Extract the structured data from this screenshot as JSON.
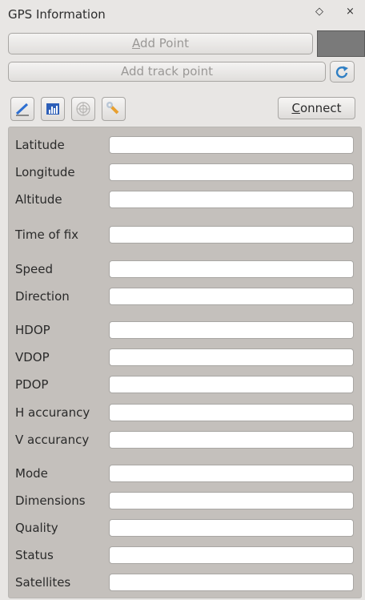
{
  "window": {
    "title": "GPS Information",
    "float_icon": "◇",
    "close_icon": "×"
  },
  "toolbar": {
    "add_point_prefix": "",
    "add_point_underline": "A",
    "add_point_rest": "dd Point",
    "add_track_point": "Add track point",
    "connect_underline": "C",
    "connect_rest": "onnect",
    "track_color": "#7a7a7a"
  },
  "tools": [
    {
      "name": "track-style-icon"
    },
    {
      "name": "signal-histogram-icon"
    },
    {
      "name": "satellite-polar-icon"
    },
    {
      "name": "settings-wrench-icon"
    }
  ],
  "fields": [
    {
      "label": "Latitude",
      "value": ""
    },
    {
      "label": "Longitude",
      "value": ""
    },
    {
      "label": "Altitude",
      "value": ""
    },
    {
      "label": "Time of fix",
      "value": ""
    },
    {
      "label": "Speed",
      "value": ""
    },
    {
      "label": "Direction",
      "value": ""
    },
    {
      "label": "HDOP",
      "value": ""
    },
    {
      "label": "VDOP",
      "value": ""
    },
    {
      "label": "PDOP",
      "value": ""
    },
    {
      "label": "H accurancy",
      "value": ""
    },
    {
      "label": "V accurancy",
      "value": ""
    },
    {
      "label": "Mode",
      "value": ""
    },
    {
      "label": "Dimensions",
      "value": ""
    },
    {
      "label": "Quality",
      "value": ""
    },
    {
      "label": "Status",
      "value": ""
    },
    {
      "label": "Satellites",
      "value": ""
    }
  ]
}
